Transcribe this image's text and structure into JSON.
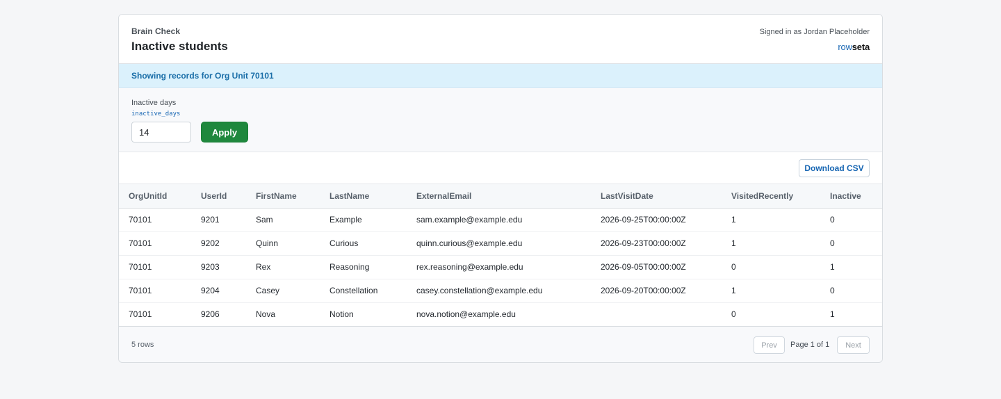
{
  "header": {
    "app_name": "Brain Check",
    "title": "Inactive students",
    "signed_in": "Signed in as Jordan Placeholder",
    "brand_part1": "row",
    "brand_part2": "seta"
  },
  "alert": {
    "text": "Showing records for Org Unit 70101"
  },
  "filters": {
    "label": "Inactive days",
    "param_name": "inactive_days",
    "value": "14",
    "apply_label": "Apply"
  },
  "toolbar": {
    "download_label": "Download CSV"
  },
  "table": {
    "columns": [
      "OrgUnitId",
      "UserId",
      "FirstName",
      "LastName",
      "ExternalEmail",
      "LastVisitDate",
      "VisitedRecently",
      "Inactive"
    ],
    "rows": [
      [
        "70101",
        "9201",
        "Sam",
        "Example",
        "sam.example@example.edu",
        "2026-09-25T00:00:00Z",
        "1",
        "0"
      ],
      [
        "70101",
        "9202",
        "Quinn",
        "Curious",
        "quinn.curious@example.edu",
        "2026-09-23T00:00:00Z",
        "1",
        "0"
      ],
      [
        "70101",
        "9203",
        "Rex",
        "Reasoning",
        "rex.reasoning@example.edu",
        "2026-09-05T00:00:00Z",
        "0",
        "1"
      ],
      [
        "70101",
        "9204",
        "Casey",
        "Constellation",
        "casey.constellation@example.edu",
        "2026-09-20T00:00:00Z",
        "1",
        "0"
      ],
      [
        "70101",
        "9206",
        "Nova",
        "Notion",
        "nova.notion@example.edu",
        "",
        "0",
        "1"
      ]
    ]
  },
  "footer": {
    "row_count": "5 rows",
    "prev_label": "Prev",
    "page_info": "Page 1 of 1",
    "next_label": "Next"
  },
  "colors": {
    "apply_button": "#1f883d",
    "alert_bg": "#dbf1fc",
    "link_blue": "#1766b3"
  }
}
